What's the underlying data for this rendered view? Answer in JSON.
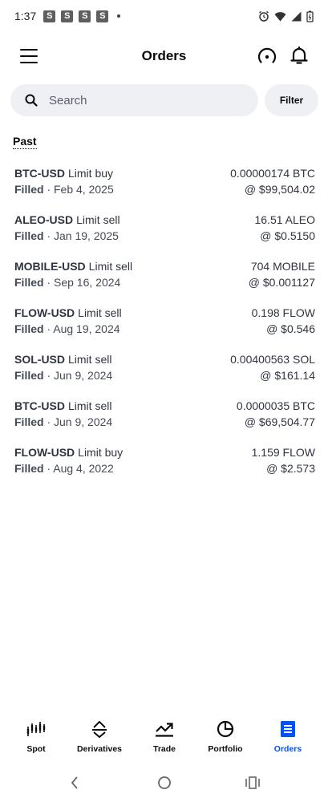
{
  "status_bar": {
    "time": "1:37",
    "badges": [
      "S",
      "S",
      "S",
      "S"
    ]
  },
  "header": {
    "title": "Orders"
  },
  "search": {
    "placeholder": "Search",
    "filter_label": "Filter"
  },
  "section": {
    "label": "Past"
  },
  "orders": [
    {
      "pair": "BTC-USD",
      "type": "Limit buy",
      "status": "Filled",
      "date": "· Feb 4, 2025",
      "amount": "0.00000174 BTC",
      "price": "@ $99,504.02"
    },
    {
      "pair": "ALEO-USD",
      "type": "Limit sell",
      "status": "Filled",
      "date": "· Jan 19, 2025",
      "amount": "16.51 ALEO",
      "price": "@ $0.5150"
    },
    {
      "pair": "MOBILE-USD",
      "type": "Limit sell",
      "status": "Filled",
      "date": "· Sep 16, 2024",
      "amount": "704 MOBILE",
      "price": "@ $0.001127"
    },
    {
      "pair": "FLOW-USD",
      "type": "Limit sell",
      "status": "Filled",
      "date": "· Aug 19, 2024",
      "amount": "0.198 FLOW",
      "price": "@ $0.546"
    },
    {
      "pair": "SOL-USD",
      "type": "Limit sell",
      "status": "Filled",
      "date": "· Jun 9, 2024",
      "amount": "0.00400563 SOL",
      "price": "@ $161.14"
    },
    {
      "pair": "BTC-USD",
      "type": "Limit sell",
      "status": "Filled",
      "date": "· Jun 9, 2024",
      "amount": "0.0000035 BTC",
      "price": "@ $69,504.77"
    },
    {
      "pair": "FLOW-USD",
      "type": "Limit buy",
      "status": "Filled",
      "date": "· Aug 4, 2022",
      "amount": "1.159 FLOW",
      "price": "@ $2.573"
    }
  ],
  "bottom_nav": {
    "items": [
      {
        "label": "Spot",
        "icon": "candlestick-icon"
      },
      {
        "label": "Derivatives",
        "icon": "derivatives-icon"
      },
      {
        "label": "Trade",
        "icon": "trend-up-icon"
      },
      {
        "label": "Portfolio",
        "icon": "pie-chart-icon"
      },
      {
        "label": "Orders",
        "icon": "orders-list-icon",
        "active": true
      }
    ]
  },
  "colors": {
    "accent": "#0052ff",
    "search_bg": "#eef0f3",
    "text": "#0a0b0d"
  }
}
